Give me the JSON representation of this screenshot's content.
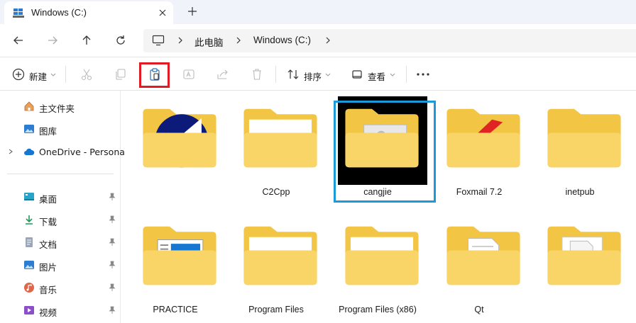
{
  "tab": {
    "title": "Windows (C:)"
  },
  "breadcrumb": [
    "此电脑",
    "Windows (C:)"
  ],
  "toolbar": {
    "new_label": "新建",
    "sort_label": "排序",
    "view_label": "查看"
  },
  "sidebar": {
    "top": [
      {
        "label": "主文件夹",
        "icon": "home-icon"
      },
      {
        "label": "图库",
        "icon": "gallery-icon"
      },
      {
        "label": "OneDrive - Persona",
        "icon": "cloud-icon"
      }
    ],
    "pinned": [
      {
        "label": "桌面",
        "icon": "desktop-icon"
      },
      {
        "label": "下载",
        "icon": "download-icon"
      },
      {
        "label": "文档",
        "icon": "document-icon"
      },
      {
        "label": "图片",
        "icon": "pictures-icon"
      },
      {
        "label": "音乐",
        "icon": "music-icon"
      },
      {
        "label": "视频",
        "icon": "video-icon"
      }
    ]
  },
  "items": [
    {
      "name": "",
      "icon": "folder-icon"
    },
    {
      "name": "C2Cpp",
      "icon": "folder-icon"
    },
    {
      "name": "cangjie",
      "icon": "folder-icon"
    },
    {
      "name": "Foxmail 7.2",
      "icon": "folder-icon"
    },
    {
      "name": "inetpub",
      "icon": "folder-icon"
    },
    {
      "name": "PRACTICE",
      "icon": "folder-icon"
    },
    {
      "name": "Program Files",
      "icon": "folder-icon"
    },
    {
      "name": "Program Files (x86)",
      "icon": "folder-icon"
    },
    {
      "name": "Qt",
      "icon": "folder-icon"
    },
    {
      "name": "",
      "icon": "folder-icon"
    }
  ],
  "colors": {
    "highlight_red": "#e01b24",
    "highlight_blue": "#1a9ad9",
    "folder": "#f9d568"
  }
}
